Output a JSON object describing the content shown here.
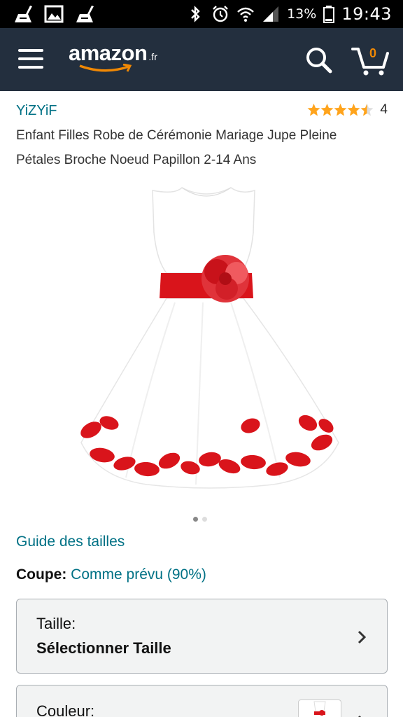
{
  "status_bar": {
    "battery_percent": "13%",
    "time": "19:43",
    "icons": [
      "cleaner-icon",
      "gallery-icon",
      "cleaner-icon",
      "bluetooth-icon",
      "alarm-icon",
      "wifi-icon",
      "signal-icon",
      "battery-icon"
    ]
  },
  "header": {
    "logo_text": "amazon",
    "logo_tld": ".fr",
    "cart_count": "0",
    "background": "#232f3e",
    "accent": "#f08804"
  },
  "product": {
    "brand": "YiZYiF",
    "rating_value": 4.5,
    "rating_count": "4",
    "title": "Enfant Filles Robe de Cérémonie Mariage Jupe Pleine Pétales Broche Noeud Papillon 2-14 Ans",
    "image_count": 2,
    "active_image": 1
  },
  "links": {
    "size_guide": "Guide des tailles"
  },
  "fit": {
    "label": "Coupe:",
    "value": "Comme prévu (90%)"
  },
  "size_selector": {
    "label": "Taille:",
    "value": "Sélectionner Taille"
  },
  "color_selector": {
    "label": "Couleur:"
  },
  "colors": {
    "link": "#007185",
    "star": "#ffa41c",
    "dress_red": "#d9141b"
  }
}
